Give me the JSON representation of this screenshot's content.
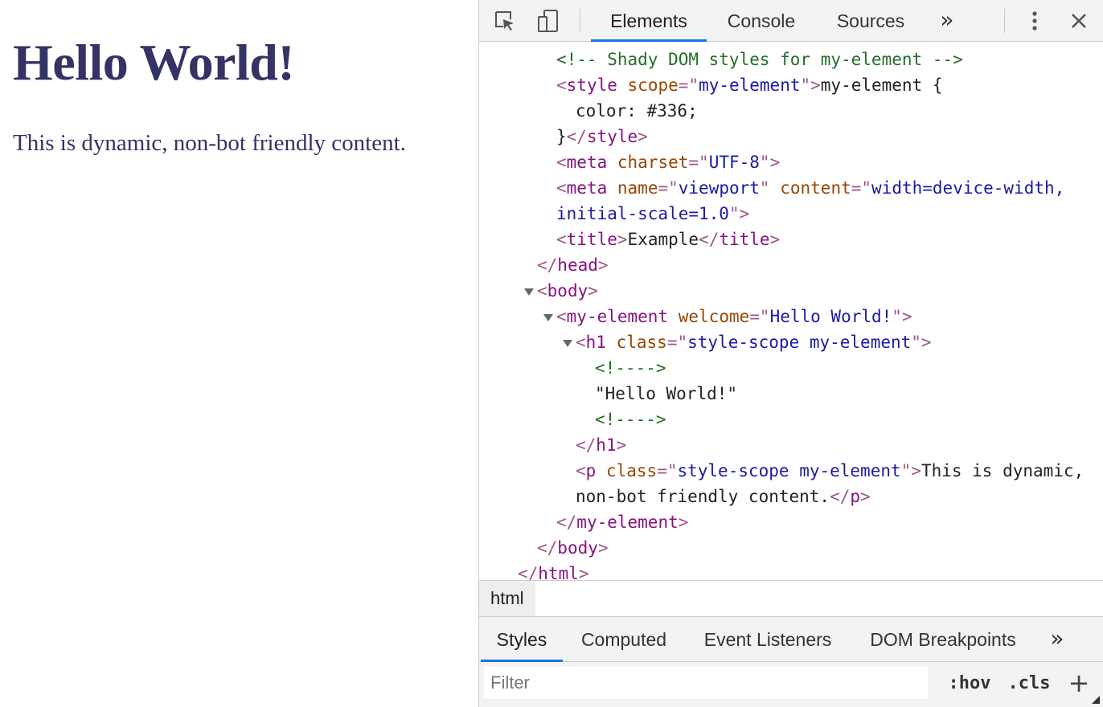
{
  "page": {
    "heading": "Hello World!",
    "paragraph": "This is dynamic, non-bot friendly content."
  },
  "devtools": {
    "tabs": [
      "Elements",
      "Console",
      "Sources"
    ],
    "active_tab": "Elements",
    "overflow_label": "»",
    "breadcrumb": "html",
    "subtabs": [
      "Styles",
      "Computed",
      "Event Listeners",
      "DOM Breakpoints"
    ],
    "active_subtab": "Styles",
    "subtab_overflow": "»",
    "filter_placeholder": "Filter",
    "hov_label": ":hov",
    "cls_label": ".cls",
    "add_label": "+",
    "accent_color": "#1a73e8",
    "icons": [
      "inspect-element-icon",
      "device-toolbar-icon",
      "more-options-icon",
      "close-icon"
    ]
  },
  "dom_lines": [
    {
      "indent": 3,
      "tokens": [
        {
          "t": "c",
          "v": "<!-- Shady DOM styles for my-element -->"
        }
      ]
    },
    {
      "indent": 3,
      "tokens": [
        {
          "t": "p",
          "v": "<"
        },
        {
          "t": "g",
          "v": "style"
        },
        {
          "t": "s",
          "v": " "
        },
        {
          "t": "a",
          "v": "scope"
        },
        {
          "t": "p",
          "v": "=\""
        },
        {
          "t": "v",
          "v": "my-element"
        },
        {
          "t": "p",
          "v": "\">"
        },
        {
          "t": "x",
          "v": "my-element {"
        }
      ]
    },
    {
      "indent": 4,
      "tokens": [
        {
          "t": "x",
          "v": "color: #336;"
        }
      ]
    },
    {
      "indent": 3,
      "tokens": [
        {
          "t": "x",
          "v": "}"
        },
        {
          "t": "p",
          "v": "</"
        },
        {
          "t": "g",
          "v": "style"
        },
        {
          "t": "p",
          "v": ">"
        }
      ]
    },
    {
      "indent": 3,
      "tokens": [
        {
          "t": "p",
          "v": "<"
        },
        {
          "t": "g",
          "v": "meta"
        },
        {
          "t": "s",
          "v": " "
        },
        {
          "t": "a",
          "v": "charset"
        },
        {
          "t": "p",
          "v": "=\""
        },
        {
          "t": "v",
          "v": "UTF-8"
        },
        {
          "t": "p",
          "v": "\">"
        }
      ]
    },
    {
      "indent": 3,
      "tokens": [
        {
          "t": "p",
          "v": "<"
        },
        {
          "t": "g",
          "v": "meta"
        },
        {
          "t": "s",
          "v": " "
        },
        {
          "t": "a",
          "v": "name"
        },
        {
          "t": "p",
          "v": "=\""
        },
        {
          "t": "v",
          "v": "viewport"
        },
        {
          "t": "p",
          "v": "\""
        },
        {
          "t": "s",
          "v": " "
        },
        {
          "t": "a",
          "v": "content"
        },
        {
          "t": "p",
          "v": "=\""
        },
        {
          "t": "v",
          "v": "width=device-width,"
        }
      ]
    },
    {
      "indent": 3,
      "tokens": [
        {
          "t": "v",
          "v": "initial-scale=1.0"
        },
        {
          "t": "p",
          "v": "\">"
        }
      ]
    },
    {
      "indent": 3,
      "tokens": [
        {
          "t": "p",
          "v": "<"
        },
        {
          "t": "g",
          "v": "title"
        },
        {
          "t": "p",
          "v": ">"
        },
        {
          "t": "x",
          "v": "Example"
        },
        {
          "t": "p",
          "v": "</"
        },
        {
          "t": "g",
          "v": "title"
        },
        {
          "t": "p",
          "v": ">"
        }
      ]
    },
    {
      "indent": 2,
      "tokens": [
        {
          "t": "p",
          "v": "</"
        },
        {
          "t": "g",
          "v": "head"
        },
        {
          "t": "p",
          "v": ">"
        }
      ]
    },
    {
      "indent": 2,
      "expander": true,
      "tokens": [
        {
          "t": "p",
          "v": "<"
        },
        {
          "t": "g",
          "v": "body"
        },
        {
          "t": "p",
          "v": ">"
        }
      ]
    },
    {
      "indent": 3,
      "expander": true,
      "tokens": [
        {
          "t": "p",
          "v": "<"
        },
        {
          "t": "g",
          "v": "my-element"
        },
        {
          "t": "s",
          "v": " "
        },
        {
          "t": "a",
          "v": "welcome"
        },
        {
          "t": "p",
          "v": "=\""
        },
        {
          "t": "v",
          "v": "Hello World!"
        },
        {
          "t": "p",
          "v": "\">"
        }
      ]
    },
    {
      "indent": 4,
      "expander": true,
      "tokens": [
        {
          "t": "p",
          "v": "<"
        },
        {
          "t": "g",
          "v": "h1"
        },
        {
          "t": "s",
          "v": " "
        },
        {
          "t": "a",
          "v": "class"
        },
        {
          "t": "p",
          "v": "=\""
        },
        {
          "t": "v",
          "v": "style-scope my-element"
        },
        {
          "t": "p",
          "v": "\">"
        }
      ]
    },
    {
      "indent": 5,
      "tokens": [
        {
          "t": "c",
          "v": "<!---->"
        }
      ]
    },
    {
      "indent": 5,
      "tokens": [
        {
          "t": "x",
          "v": "\"Hello World!\""
        }
      ]
    },
    {
      "indent": 5,
      "tokens": [
        {
          "t": "c",
          "v": "<!---->"
        }
      ]
    },
    {
      "indent": 4,
      "tokens": [
        {
          "t": "p",
          "v": "</"
        },
        {
          "t": "g",
          "v": "h1"
        },
        {
          "t": "p",
          "v": ">"
        }
      ]
    },
    {
      "indent": 4,
      "tokens": [
        {
          "t": "p",
          "v": "<"
        },
        {
          "t": "g",
          "v": "p"
        },
        {
          "t": "s",
          "v": " "
        },
        {
          "t": "a",
          "v": "class"
        },
        {
          "t": "p",
          "v": "=\""
        },
        {
          "t": "v",
          "v": "style-scope my-element"
        },
        {
          "t": "p",
          "v": "\">"
        },
        {
          "t": "x",
          "v": "This is dynamic,"
        }
      ]
    },
    {
      "indent": 4,
      "tokens": [
        {
          "t": "x",
          "v": "non-bot friendly content."
        },
        {
          "t": "p",
          "v": "</"
        },
        {
          "t": "g",
          "v": "p"
        },
        {
          "t": "p",
          "v": ">"
        }
      ]
    },
    {
      "indent": 3,
      "tokens": [
        {
          "t": "p",
          "v": "</"
        },
        {
          "t": "g",
          "v": "my-element"
        },
        {
          "t": "p",
          "v": ">"
        }
      ]
    },
    {
      "indent": 2,
      "tokens": [
        {
          "t": "p",
          "v": "</"
        },
        {
          "t": "g",
          "v": "body"
        },
        {
          "t": "p",
          "v": ">"
        }
      ]
    },
    {
      "indent": 1,
      "tokens": [
        {
          "t": "p",
          "v": "</"
        },
        {
          "t": "g",
          "v": "html"
        },
        {
          "t": "p",
          "v": ">"
        }
      ]
    }
  ]
}
